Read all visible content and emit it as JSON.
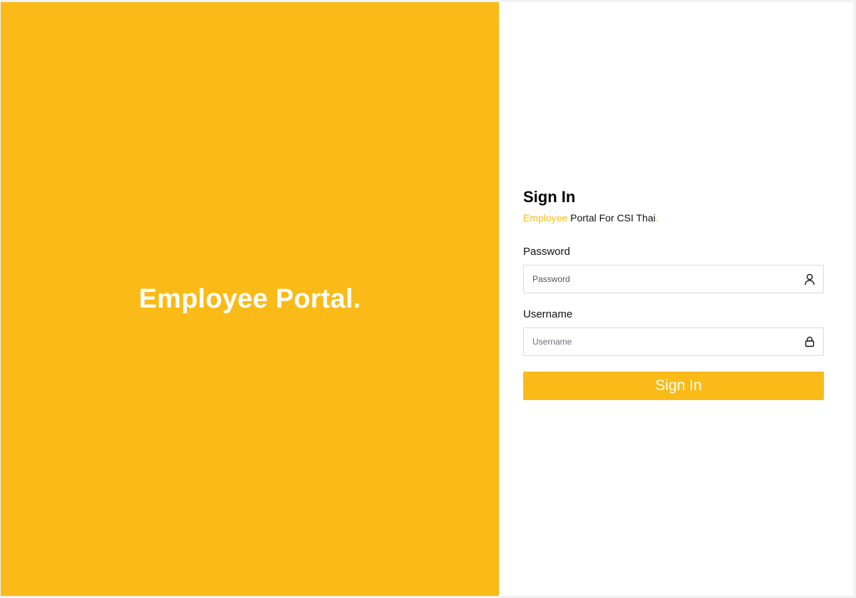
{
  "hero": {
    "title": "Employee Portal."
  },
  "form": {
    "title": "Sign In",
    "subtitle": {
      "accent": "Employee",
      "rest": " Portal For CSI Thai",
      "dot": "."
    },
    "password": {
      "label": "Password",
      "placeholder": "Password",
      "value": "",
      "icon": "user-icon"
    },
    "username": {
      "label": "Username",
      "placeholder": "Username",
      "value": "",
      "icon": "lock-icon"
    },
    "submit_label": "Sign In"
  },
  "colors": {
    "accent": "#FABB18",
    "white": "#FFFFFF",
    "border": "#DADADA"
  }
}
